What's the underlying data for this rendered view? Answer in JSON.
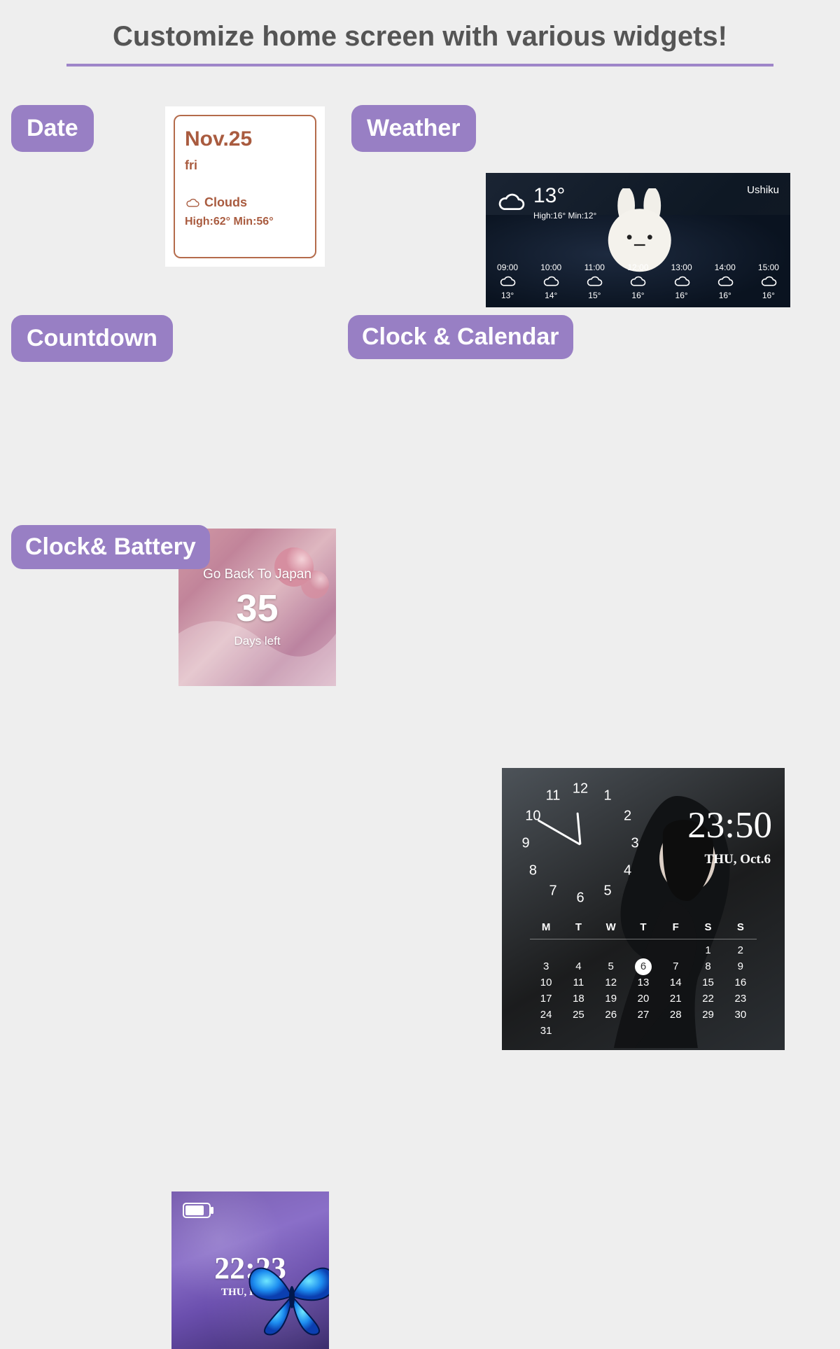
{
  "page": {
    "title": "Customize home screen with various widgets!"
  },
  "tags": {
    "date": "Date",
    "weather": "Weather",
    "countdown": "Countdown",
    "clock_calendar": "Clock & Calendar",
    "clock_battery": "Clock& Battery"
  },
  "date_widget": {
    "date": "Nov.25",
    "weekday": "fri",
    "condition": "Clouds",
    "hilo": "High:62° Min:56°"
  },
  "weather_widget": {
    "temp": "13°",
    "range": "High:16° Min:12°",
    "location": "Ushiku",
    "hours": [
      {
        "t": "09:00",
        "temp": "13°"
      },
      {
        "t": "10:00",
        "temp": "14°"
      },
      {
        "t": "11:00",
        "temp": "15°"
      },
      {
        "t": "12:00",
        "temp": "16°"
      },
      {
        "t": "13:00",
        "temp": "16°"
      },
      {
        "t": "14:00",
        "temp": "16°"
      },
      {
        "t": "15:00",
        "temp": "16°"
      }
    ]
  },
  "countdown_widget": {
    "title": "Go Back To Japan",
    "number": "35",
    "sub": "Days left"
  },
  "clock_battery_widget": {
    "time": "22:23",
    "date": "THU, Feb.17",
    "battery_level": 80
  },
  "clock_calendar_widget": {
    "time": "23:50",
    "date": "THU, Oct.6",
    "analog_hours": [
      "12",
      "1",
      "2",
      "3",
      "4",
      "5",
      "6",
      "7",
      "8",
      "9",
      "10",
      "11"
    ],
    "weekdays": [
      "M",
      "T",
      "W",
      "T",
      "F",
      "S",
      "S"
    ],
    "today": 6,
    "weeks": [
      [
        "",
        "",
        "",
        "",
        "",
        "1",
        "2"
      ],
      [
        "3",
        "4",
        "5",
        "6",
        "7",
        "8",
        "9"
      ],
      [
        "10",
        "11",
        "12",
        "13",
        "14",
        "15",
        "16"
      ],
      [
        "17",
        "18",
        "19",
        "20",
        "21",
        "22",
        "23"
      ],
      [
        "24",
        "25",
        "26",
        "27",
        "28",
        "29",
        "30"
      ],
      [
        "31",
        "",
        "",
        "",
        "",
        "",
        ""
      ]
    ]
  }
}
